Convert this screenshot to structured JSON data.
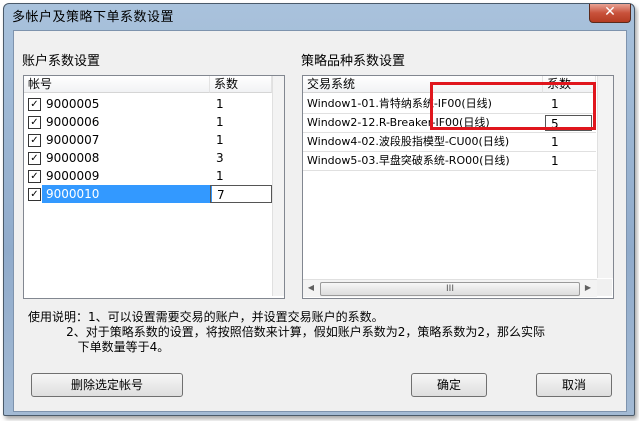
{
  "window": {
    "title": "多帐户及策略下单系数设置",
    "close_glyph": "✕"
  },
  "accounts": {
    "section_label": "账户系数设置",
    "col_account": "帐号",
    "col_coef": "系数",
    "rows": [
      {
        "account": "9000005",
        "coef": "1",
        "checked": true
      },
      {
        "account": "9000006",
        "coef": "1",
        "checked": true
      },
      {
        "account": "9000007",
        "coef": "1",
        "checked": true
      },
      {
        "account": "9000008",
        "coef": "3",
        "checked": true
      },
      {
        "account": "9000009",
        "coef": "1",
        "checked": true
      },
      {
        "account": "9000010",
        "coef": "7",
        "checked": true,
        "selected": true
      }
    ]
  },
  "strategies": {
    "section_label": "策略品种系数设置",
    "col_system": "交易系统",
    "col_coef": "系数",
    "rows": [
      {
        "system": "Window1-01.肯特纳系统-IF00(日线)",
        "coef": "1"
      },
      {
        "system": "Window2-12.R-Breaker-IF00(日线)",
        "coef": "5"
      },
      {
        "system": "Window4-02.波段股指模型-CU00(日线)",
        "coef": "1"
      },
      {
        "system": "Window5-03.早盘突破系统-RO00(日线)",
        "coef": "1"
      }
    ],
    "scroll_thumb_glyph": "III"
  },
  "instructions": {
    "line1": "使用说明：1、可以设置需要交易的账户，并设置交易账户的系数。",
    "line2": "          2、对于策略系数的设置，将按照倍数来计算，假如账户系数为2，策略系数为2，那么实际",
    "line3": "             下单数量等于4。"
  },
  "buttons": {
    "delete": "删除选定帐号",
    "ok": "确定",
    "cancel": "取消"
  },
  "colors": {
    "selection": "#3399ff",
    "highlight_box": "#e0161d",
    "close_button": "#c8523b"
  }
}
